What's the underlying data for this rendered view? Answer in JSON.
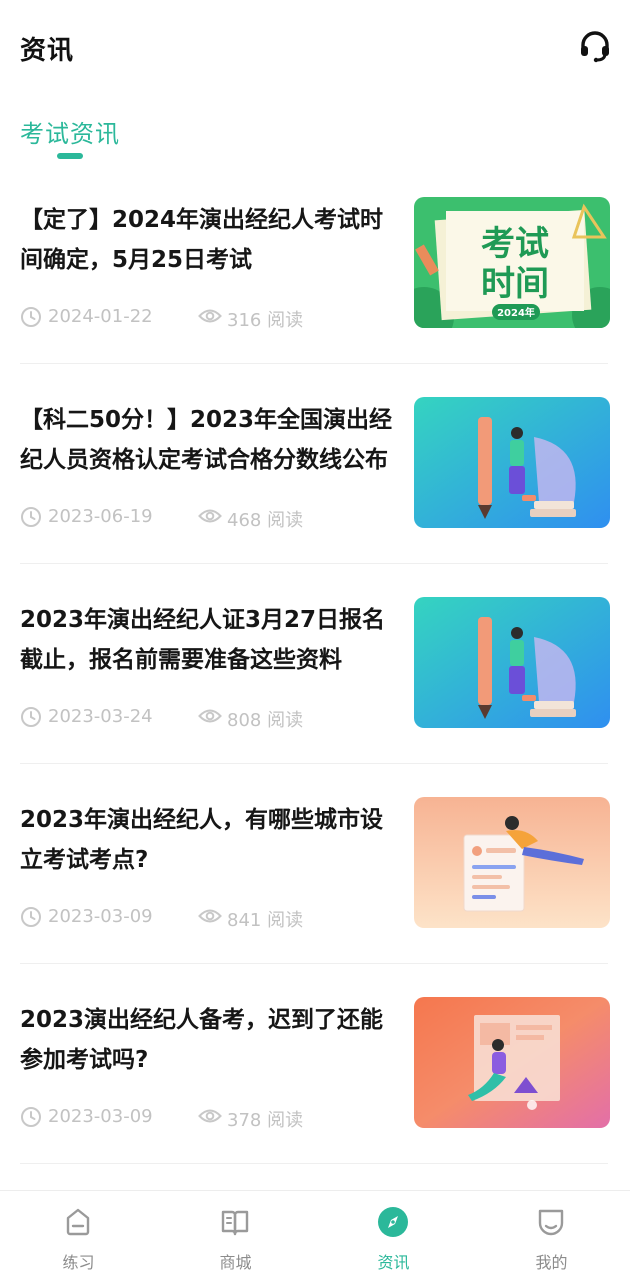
{
  "header": {
    "title": "资讯",
    "support_icon": "headset-icon"
  },
  "tabs": [
    {
      "label": "考试资讯",
      "active": true
    }
  ],
  "colors": {
    "accent": "#2bb89a",
    "meta": "#c2c2c2",
    "inactive": "#8c8c8c"
  },
  "articles": [
    {
      "title": "【定了】2024年演出经纪人考试时间确定，5月25日考试",
      "date": "2024-01-22",
      "reads": "316 阅读",
      "thumb_text": [
        "考试",
        "时间",
        "2024年"
      ]
    },
    {
      "title": "【科二50分！】2023年全国演出经纪人员资格认定考试合格分数线公布",
      "date": "2023-06-19",
      "reads": "468 阅读"
    },
    {
      "title": "2023年演出经纪人证3月27日报名截止，报名前需要准备这些资料",
      "date": "2023-03-24",
      "reads": "808 阅读"
    },
    {
      "title": "2023年演出经纪人，有哪些城市设立考试考点?",
      "date": "2023-03-09",
      "reads": "841 阅读"
    },
    {
      "title": "2023演出经纪人备考，迟到了还能参加考试吗?",
      "date": "2023-03-09",
      "reads": "378 阅读"
    }
  ],
  "tabbar": [
    {
      "label": "练习",
      "icon": "practice-icon",
      "active": false
    },
    {
      "label": "商城",
      "icon": "book-icon",
      "active": false
    },
    {
      "label": "资讯",
      "icon": "compass-icon",
      "active": true
    },
    {
      "label": "我的",
      "icon": "profile-icon",
      "active": false
    }
  ]
}
